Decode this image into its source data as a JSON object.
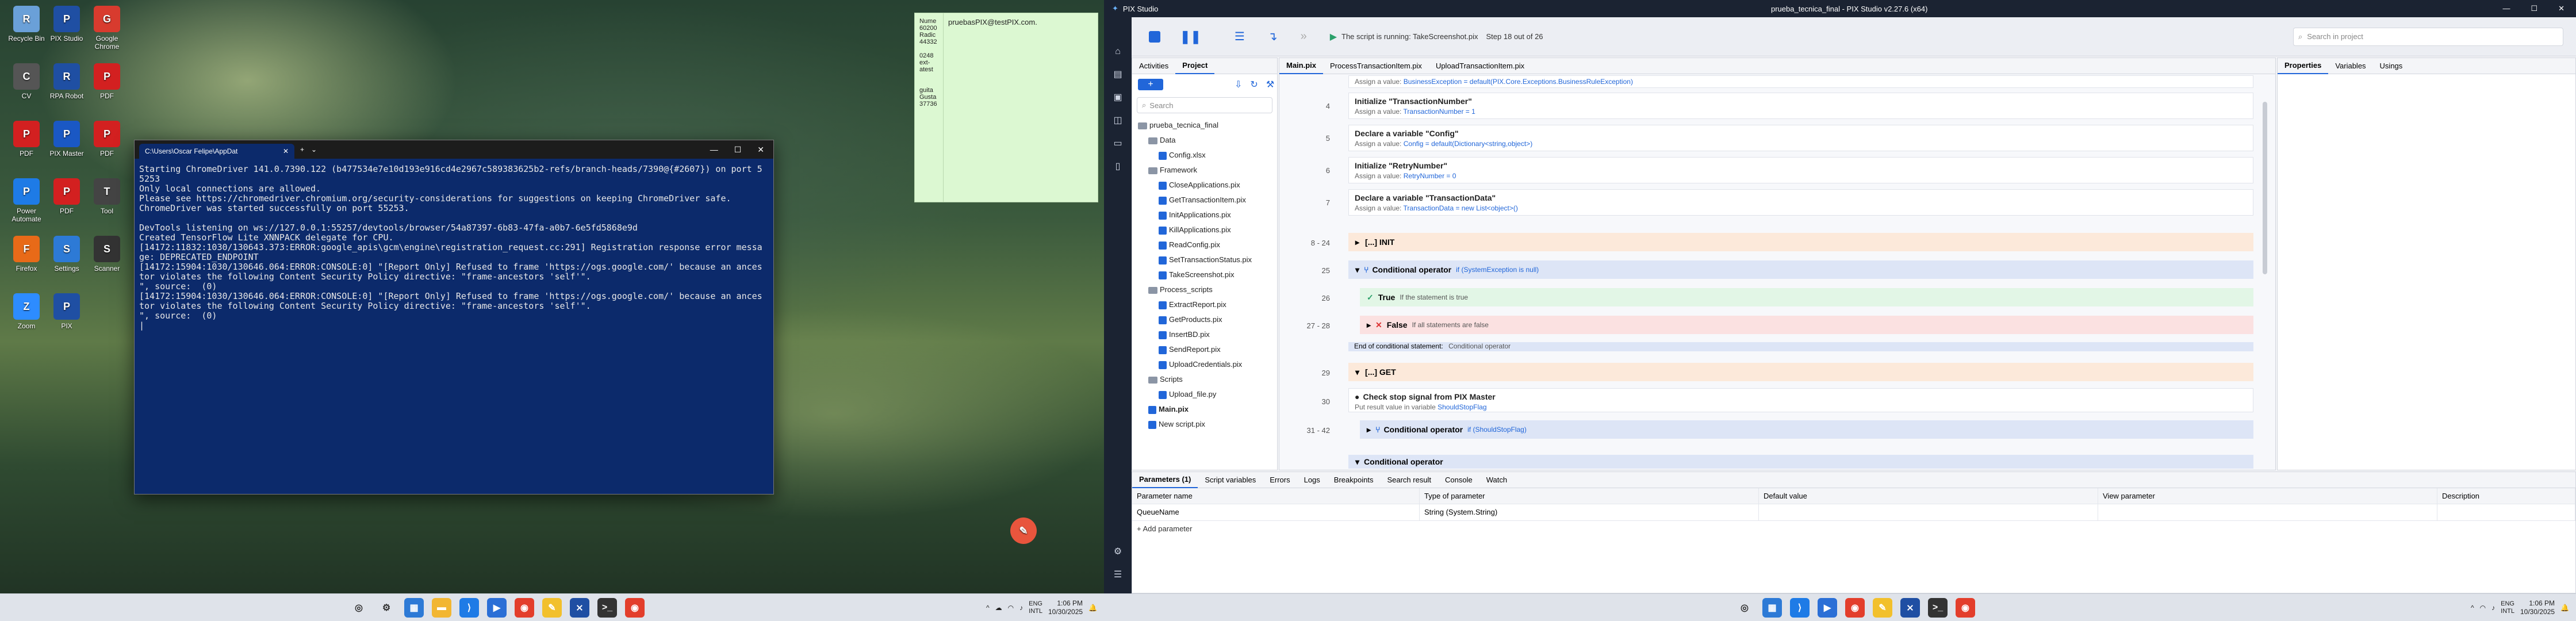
{
  "desktop_icons": [
    {
      "label": "Recycle Bin",
      "color": "#6aa0d8"
    },
    {
      "label": "PIX Studio",
      "color": "#1f4fa3"
    },
    {
      "label": "Google Chrome",
      "color": "#d83b2e"
    },
    {
      "label": "CV",
      "color": "#555"
    },
    {
      "label": "RPA Robot",
      "color": "#1f4fa3"
    },
    {
      "label": "PDF",
      "color": "#d32020"
    },
    {
      "label": "PDF",
      "color": "#d32020"
    },
    {
      "label": "PIX Master",
      "color": "#1a58c4"
    },
    {
      "label": "PDF",
      "color": "#d32020"
    },
    {
      "label": "Power Automate",
      "color": "#1e7be6"
    },
    {
      "label": "PDF",
      "color": "#d32020"
    },
    {
      "label": "Tool",
      "color": "#444"
    },
    {
      "label": "Firefox",
      "color": "#e86a18"
    },
    {
      "label": "Settings",
      "color": "#2d7ad6"
    },
    {
      "label": "Scanner",
      "color": "#333"
    },
    {
      "label": "Zoom",
      "color": "#2d8cff"
    },
    {
      "label": "PIX",
      "color": "#1f4fa3"
    }
  ],
  "terminal": {
    "tab_title": "C:\\Users\\Oscar Felipe\\AppDat",
    "lines": [
      "Starting ChromeDriver 141.0.7390.122 (b477534e7e10d193e916cd4e2967c589383625b2-refs/branch-heads/7390@{#2607}) on port 5",
      "5253",
      "Only local connections are allowed.",
      "Please see https://chromedriver.chromium.org/security-considerations for suggestions on keeping ChromeDriver safe.",
      "ChromeDriver was started successfully on port 55253.",
      "",
      "DevTools listening on ws://127.0.0.1:55257/devtools/browser/54a87397-6b83-47fa-a0b7-6e5fd5868e9d",
      "Created TensorFlow Lite XNNPACK delegate for CPU.",
      "[14172:11832:1030/130643.373:ERROR:google_apis\\gcm\\engine\\registration_request.cc:291] Registration response error messa",
      "ge: DEPRECATED_ENDPOINT",
      "[14172:15904:1030/130646.064:ERROR:CONSOLE:0] \"[Report Only] Refused to frame 'https://ogs.google.com/' because an ances",
      "tor violates the following Content Security Policy directive: \"frame-ancestors 'self'\".",
      "\", source:  (0)",
      "[14172:15904:1030/130646.064:ERROR:CONSOLE:0] \"[Report Only] Refused to frame 'https://ogs.google.com/' because an ances",
      "tor violates the following Content Security Policy directive: \"frame-ancestors 'self'\".",
      "\", source:  (0)",
      "|"
    ]
  },
  "sticky": {
    "note1": "Nume\n60200\nRadic\n44332\n\n0248\next-\natest\n\n\nguita\nGusta\n37736",
    "note2": "pruebasPIX@testPIX.com."
  },
  "taskbar": {
    "time": "1:06 PM",
    "date": "10/30/2025",
    "lang": "ENG\nINTL"
  },
  "pix": {
    "title": "prueba_tecnica_final - PIX Studio v2.27.6 (x64)",
    "app_name": "PIX Studio",
    "running_status": "The script is running: TakeScreenshot.pix",
    "step_status": "Step 18 out of 26",
    "search_placeholder": "Search in project",
    "left_tabs": [
      "Activities",
      "Project"
    ],
    "add_btn": "+",
    "tree_search": "Search",
    "tree": [
      {
        "t": "prueba_tecnica_final",
        "k": "proj",
        "d": 0
      },
      {
        "t": "Data",
        "k": "folder",
        "d": 1
      },
      {
        "t": "Config.xlsx",
        "k": "file",
        "d": 2
      },
      {
        "t": "Framework",
        "k": "folder",
        "d": 1
      },
      {
        "t": "CloseApplications.pix",
        "k": "file",
        "d": 2
      },
      {
        "t": "GetTransactionItem.pix",
        "k": "file",
        "d": 2
      },
      {
        "t": "InitApplications.pix",
        "k": "file",
        "d": 2
      },
      {
        "t": "KillApplications.pix",
        "k": "file",
        "d": 2
      },
      {
        "t": "ReadConfig.pix",
        "k": "file",
        "d": 2
      },
      {
        "t": "SetTransactionStatus.pix",
        "k": "file",
        "d": 2
      },
      {
        "t": "TakeScreenshot.pix",
        "k": "file",
        "d": 2
      },
      {
        "t": "Process_scripts",
        "k": "folder",
        "d": 1
      },
      {
        "t": "ExtractReport.pix",
        "k": "file",
        "d": 2
      },
      {
        "t": "GetProducts.pix",
        "k": "file",
        "d": 2
      },
      {
        "t": "InsertBD.pix",
        "k": "file",
        "d": 2
      },
      {
        "t": "SendReport.pix",
        "k": "file",
        "d": 2
      },
      {
        "t": "UploadCredentials.pix",
        "k": "file",
        "d": 2
      },
      {
        "t": "Scripts",
        "k": "folder",
        "d": 1
      },
      {
        "t": "Upload_file.py",
        "k": "file",
        "d": 2
      },
      {
        "t": "Main.pix",
        "k": "file",
        "d": 1
      },
      {
        "t": "New script.pix",
        "k": "file",
        "d": 1
      }
    ],
    "doc_tabs": [
      "Main.pix",
      "ProcessTransactionItem.pix",
      "UploadTransactionItem.pix"
    ],
    "top_step": {
      "sub": "Assign a value:",
      "val": "BusinessException = default(PIX.Core.Exceptions.BusinessRuleException)"
    },
    "steps": [
      {
        "n": "4",
        "title": "Initialize \"TransactionNumber\"",
        "sub": "Assign a value:",
        "val": "TransactionNumber = 1"
      },
      {
        "n": "5",
        "title": "Declare a variable \"Config\"",
        "sub": "Assign a value:",
        "val": "Config = default(Dictionary<string,object>)"
      },
      {
        "n": "6",
        "title": "Initialize \"RetryNumber\"",
        "sub": "Assign a value:",
        "val": "RetryNumber = 0"
      },
      {
        "n": "7",
        "title": "Declare a variable \"TransactionData\"",
        "sub": "Assign a value:",
        "val": "TransactionData = new List<object>()"
      }
    ],
    "blocks": {
      "init_n": "8 - 24",
      "init": "[...] INIT",
      "cond_n": "25",
      "cond": "Conditional operator",
      "cond_if": "if (SystemException is null)",
      "true_n": "26",
      "true_t": "True",
      "true_s": "If the statement is true",
      "false_n": "27 - 28",
      "false_t": "False",
      "false_s": "If all statements are false",
      "end_t": "End of conditional statement:",
      "end_s": "Conditional operator",
      "get_n": "29",
      "get": "[...] GET",
      "sig_n": "30",
      "sig_t": "Check stop signal from PIX Master",
      "sig_s": "Put result value in variable",
      "sig_v": "ShouldStopFlag",
      "cond2_n": "31 - 42",
      "cond2": "Conditional operator",
      "cond2_if": "if (ShouldStopFlag)",
      "cond3": "Conditional operator"
    },
    "right_tabs": [
      "Properties",
      "Variables",
      "Usings"
    ],
    "bottom_tabs": [
      "Parameters (1)",
      "Script variables",
      "Errors",
      "Logs",
      "Breakpoints",
      "Search result",
      "Console",
      "Watch"
    ],
    "param_headers": [
      "Parameter name",
      "Type of parameter",
      "Default value",
      "View parameter",
      "Description"
    ],
    "param_row": [
      "QueueName",
      "String (System.String)",
      "",
      "",
      ""
    ],
    "add_param": "+ Add parameter"
  },
  "colors": {
    "accent": "#2166d9",
    "dark": "#1b2332"
  }
}
